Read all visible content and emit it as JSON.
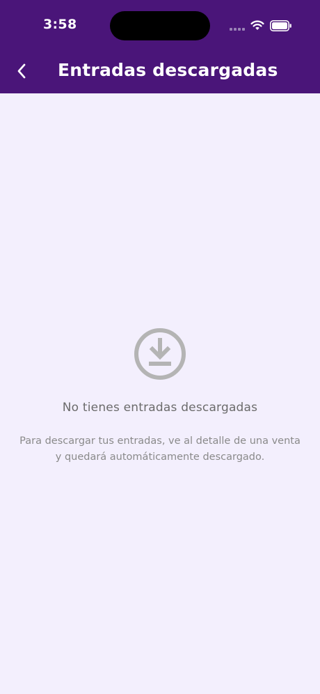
{
  "status_bar": {
    "time": "3:58",
    "icons": [
      "signal-icon",
      "wifi-icon",
      "battery-icon"
    ]
  },
  "header": {
    "title": "Entradas descargadas",
    "back_icon": "chevron-left-icon",
    "background_color": "#4a1579"
  },
  "empty_state": {
    "icon": "download-circle-icon",
    "title": "No tienes entradas descargadas",
    "description": "Para descargar tus entradas, ve al detalle de una venta y quedará automáticamente descargado."
  },
  "colors": {
    "page_background": "#f3effd",
    "icon_gray": "#b4b4b4"
  }
}
